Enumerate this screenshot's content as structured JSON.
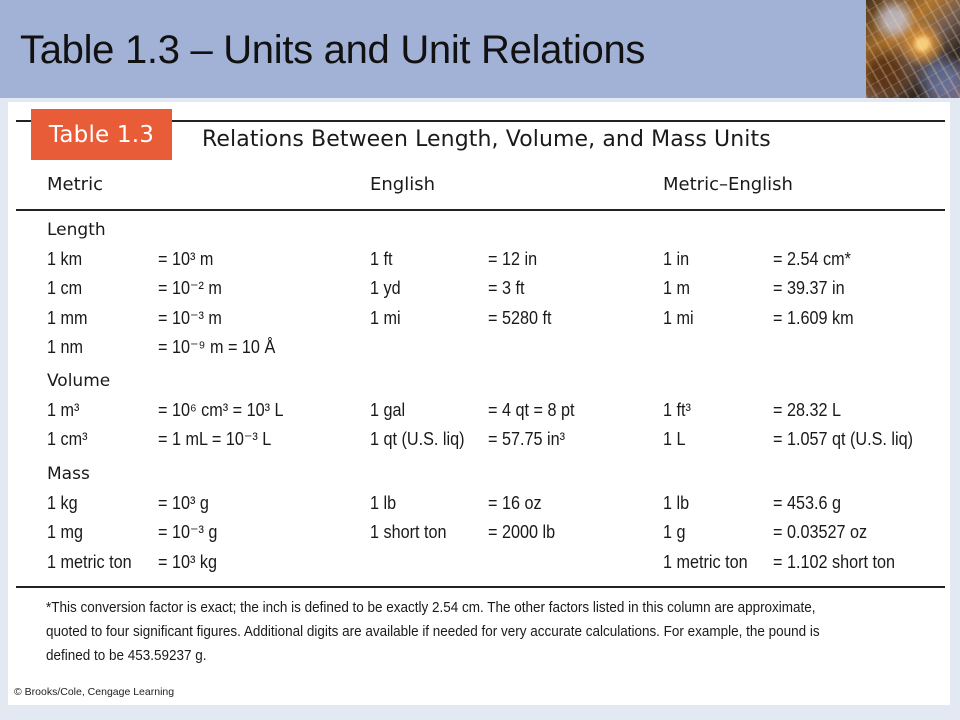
{
  "slide": {
    "title": "Table 1.3 – Units and Unit Relations",
    "corner_image": "nebula-photo"
  },
  "table": {
    "badge": "Table 1.3",
    "title": "Relations Between Length, Volume, and Mass Units",
    "columns": [
      "Metric",
      "English",
      "Metric–English"
    ],
    "sections": [
      {
        "label": "Length",
        "rows": [
          {
            "metric": [
              "1 km",
              "= 10³ m"
            ],
            "english": [
              "1 ft",
              "= 12 in"
            ],
            "metric_english": [
              "1 in",
              "= 2.54 cm*"
            ]
          },
          {
            "metric": [
              "1 cm",
              "= 10⁻² m"
            ],
            "english": [
              "1 yd",
              "= 3 ft"
            ],
            "metric_english": [
              "1 m",
              "= 39.37 in"
            ]
          },
          {
            "metric": [
              "1 mm",
              "= 10⁻³ m"
            ],
            "english": [
              "1 mi",
              "= 5280 ft"
            ],
            "metric_english": [
              "1 mi",
              "= 1.609 km"
            ]
          },
          {
            "metric": [
              "1 nm",
              "= 10⁻⁹ m = 10 Å"
            ],
            "english": [
              "",
              ""
            ],
            "metric_english": [
              "",
              ""
            ]
          }
        ]
      },
      {
        "label": "Volume",
        "rows": [
          {
            "metric": [
              "1 m³",
              "= 10⁶ cm³ = 10³ L"
            ],
            "english": [
              "1 gal",
              "= 4 qt = 8 pt"
            ],
            "metric_english": [
              "1 ft³",
              "= 28.32 L"
            ]
          },
          {
            "metric": [
              "1 cm³",
              "= 1 mL = 10⁻³ L"
            ],
            "english": [
              "1 qt (U.S. liq)",
              "= 57.75 in³"
            ],
            "metric_english": [
              "1 L",
              "= 1.057 qt (U.S. liq)"
            ]
          }
        ]
      },
      {
        "label": "Mass",
        "rows": [
          {
            "metric": [
              "1 kg",
              "= 10³ g"
            ],
            "english": [
              "1 lb",
              "= 16 oz"
            ],
            "metric_english": [
              "1 lb",
              "= 453.6 g"
            ]
          },
          {
            "metric": [
              "1 mg",
              "= 10⁻³ g"
            ],
            "english": [
              "1 short ton",
              "= 2000 lb"
            ],
            "metric_english": [
              "1 g",
              "= 0.03527 oz"
            ]
          },
          {
            "metric": [
              "1 metric ton",
              "= 10³ kg"
            ],
            "english": [
              "",
              ""
            ],
            "metric_english": [
              "1 metric ton",
              "= 1.102 short ton"
            ]
          }
        ]
      }
    ],
    "footnote_lines": [
      "*This conversion factor is exact; the inch is defined to be exactly 2.54 cm. The other factors listed in this column are approximate,",
      "quoted to four significant figures. Additional digits are available if needed for very accurate calculations. For example, the pound is",
      "defined to be 453.59237 g."
    ],
    "credit": "© Brooks/Cole, Cengage Learning"
  }
}
